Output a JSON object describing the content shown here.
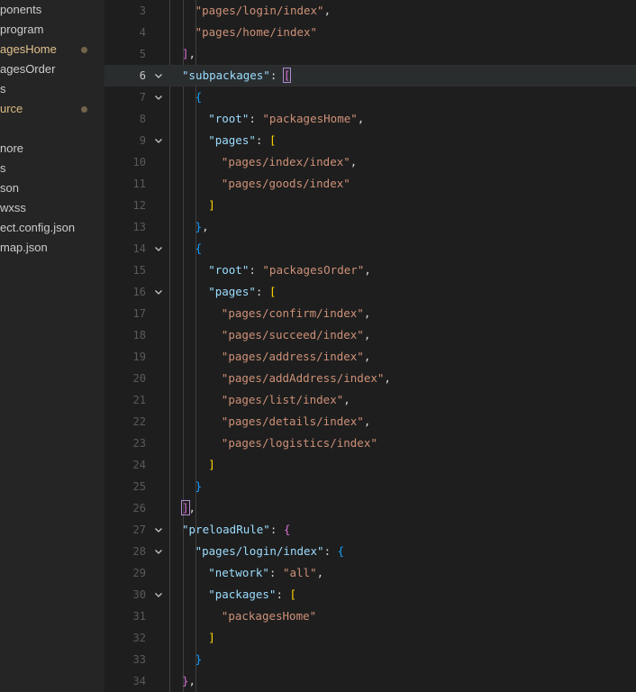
{
  "colors": {
    "sidebar_bg": "#252526",
    "editor_bg": "#1e1e1e",
    "key": "#9cdcfe",
    "string": "#ce9178",
    "punctuation": "#d4d4d4",
    "bracket_gold": "#ffd700",
    "bracket_purple": "#da70d6",
    "bracket_blue": "#179fff",
    "modified": "#e2c08d",
    "untracked": "#d7ba7d"
  },
  "explorer": {
    "items": [
      {
        "label": "ponents",
        "color": "#cccccc",
        "modified": false
      },
      {
        "label": "program",
        "color": "#cccccc",
        "modified": false
      },
      {
        "label": "agesHome",
        "color": "#e2c08d",
        "modified": true
      },
      {
        "label": "agesOrder",
        "color": "#cccccc",
        "modified": false
      },
      {
        "label": "s",
        "color": "#cccccc",
        "modified": false
      },
      {
        "label": "urce",
        "color": "#d7ba7d",
        "modified": true
      },
      {
        "label": "",
        "color": "#cccccc",
        "modified": false
      },
      {
        "label": "nore",
        "color": "#cccccc",
        "modified": false
      },
      {
        "label": "s",
        "color": "#cccccc",
        "modified": false
      },
      {
        "label": "son",
        "color": "#cccccc",
        "modified": false
      },
      {
        "label": "wxss",
        "color": "#cccccc",
        "modified": false
      },
      {
        "label": "ect.config.json",
        "color": "#cccccc",
        "modified": false
      },
      {
        "label": "map.json",
        "color": "#cccccc",
        "modified": false
      }
    ]
  },
  "editor": {
    "current_line": 6,
    "lines": [
      {
        "n": "3",
        "indent": 2,
        "fold": false,
        "tokens": [
          [
            "str",
            "\"pages/login/index\""
          ],
          [
            "punc",
            ","
          ]
        ]
      },
      {
        "n": "4",
        "indent": 2,
        "fold": false,
        "tokens": [
          [
            "str",
            "\"pages/home/index\""
          ]
        ]
      },
      {
        "n": "5",
        "indent": 1,
        "fold": false,
        "tokens": [
          [
            "b2",
            "]"
          ],
          [
            "punc",
            ","
          ]
        ]
      },
      {
        "n": "6",
        "indent": 1,
        "fold": true,
        "tokens": [
          [
            "key",
            "\"subpackages\""
          ],
          [
            "punc",
            ": "
          ],
          [
            "b2m",
            "["
          ]
        ]
      },
      {
        "n": "7",
        "indent": 2,
        "fold": true,
        "tokens": [
          [
            "b3",
            "{"
          ]
        ]
      },
      {
        "n": "8",
        "indent": 3,
        "fold": false,
        "tokens": [
          [
            "key",
            "\"root\""
          ],
          [
            "punc",
            ": "
          ],
          [
            "str",
            "\"packagesHome\""
          ],
          [
            "punc",
            ","
          ]
        ]
      },
      {
        "n": "9",
        "indent": 3,
        "fold": true,
        "tokens": [
          [
            "key",
            "\"pages\""
          ],
          [
            "punc",
            ": "
          ],
          [
            "b1",
            "["
          ]
        ]
      },
      {
        "n": "10",
        "indent": 4,
        "fold": false,
        "tokens": [
          [
            "str",
            "\"pages/index/index\""
          ],
          [
            "punc",
            ","
          ]
        ]
      },
      {
        "n": "11",
        "indent": 4,
        "fold": false,
        "tokens": [
          [
            "str",
            "\"pages/goods/index\""
          ]
        ]
      },
      {
        "n": "12",
        "indent": 3,
        "fold": false,
        "tokens": [
          [
            "b1",
            "]"
          ]
        ]
      },
      {
        "n": "13",
        "indent": 2,
        "fold": false,
        "tokens": [
          [
            "b3",
            "}"
          ],
          [
            "punc",
            ","
          ]
        ]
      },
      {
        "n": "14",
        "indent": 2,
        "fold": true,
        "tokens": [
          [
            "b3",
            "{"
          ]
        ]
      },
      {
        "n": "15",
        "indent": 3,
        "fold": false,
        "tokens": [
          [
            "key",
            "\"root\""
          ],
          [
            "punc",
            ": "
          ],
          [
            "str",
            "\"packagesOrder\""
          ],
          [
            "punc",
            ","
          ]
        ]
      },
      {
        "n": "16",
        "indent": 3,
        "fold": true,
        "tokens": [
          [
            "key",
            "\"pages\""
          ],
          [
            "punc",
            ": "
          ],
          [
            "b1",
            "["
          ]
        ]
      },
      {
        "n": "17",
        "indent": 4,
        "fold": false,
        "tokens": [
          [
            "str",
            "\"pages/confirm/index\""
          ],
          [
            "punc",
            ","
          ]
        ]
      },
      {
        "n": "18",
        "indent": 4,
        "fold": false,
        "tokens": [
          [
            "str",
            "\"pages/succeed/index\""
          ],
          [
            "punc",
            ","
          ]
        ]
      },
      {
        "n": "19",
        "indent": 4,
        "fold": false,
        "tokens": [
          [
            "str",
            "\"pages/address/index\""
          ],
          [
            "punc",
            ","
          ]
        ]
      },
      {
        "n": "20",
        "indent": 4,
        "fold": false,
        "tokens": [
          [
            "str",
            "\"pages/addAddress/index\""
          ],
          [
            "punc",
            ","
          ]
        ]
      },
      {
        "n": "21",
        "indent": 4,
        "fold": false,
        "tokens": [
          [
            "str",
            "\"pages/list/index\""
          ],
          [
            "punc",
            ","
          ]
        ]
      },
      {
        "n": "22",
        "indent": 4,
        "fold": false,
        "tokens": [
          [
            "str",
            "\"pages/details/index\""
          ],
          [
            "punc",
            ","
          ]
        ]
      },
      {
        "n": "23",
        "indent": 4,
        "fold": false,
        "tokens": [
          [
            "str",
            "\"pages/logistics/index\""
          ]
        ]
      },
      {
        "n": "24",
        "indent": 3,
        "fold": false,
        "tokens": [
          [
            "b1",
            "]"
          ]
        ]
      },
      {
        "n": "25",
        "indent": 2,
        "fold": false,
        "tokens": [
          [
            "b3",
            "}"
          ]
        ]
      },
      {
        "n": "26",
        "indent": 1,
        "fold": false,
        "tokens": [
          [
            "b2m",
            "]"
          ],
          [
            "punc",
            ","
          ]
        ]
      },
      {
        "n": "27",
        "indent": 1,
        "fold": true,
        "tokens": [
          [
            "key",
            "\"preloadRule\""
          ],
          [
            "punc",
            ": "
          ],
          [
            "b2",
            "{"
          ]
        ]
      },
      {
        "n": "28",
        "indent": 2,
        "fold": true,
        "tokens": [
          [
            "key",
            "\"pages/login/index\""
          ],
          [
            "punc",
            ": "
          ],
          [
            "b3",
            "{"
          ]
        ]
      },
      {
        "n": "29",
        "indent": 3,
        "fold": false,
        "tokens": [
          [
            "key",
            "\"network\""
          ],
          [
            "punc",
            ": "
          ],
          [
            "str",
            "\"all\""
          ],
          [
            "punc",
            ","
          ]
        ]
      },
      {
        "n": "30",
        "indent": 3,
        "fold": true,
        "tokens": [
          [
            "key",
            "\"packages\""
          ],
          [
            "punc",
            ": "
          ],
          [
            "b1",
            "["
          ]
        ]
      },
      {
        "n": "31",
        "indent": 4,
        "fold": false,
        "tokens": [
          [
            "str",
            "\"packagesHome\""
          ]
        ]
      },
      {
        "n": "32",
        "indent": 3,
        "fold": false,
        "tokens": [
          [
            "b1",
            "]"
          ]
        ]
      },
      {
        "n": "33",
        "indent": 2,
        "fold": false,
        "tokens": [
          [
            "b3",
            "}"
          ]
        ]
      },
      {
        "n": "34",
        "indent": 1,
        "fold": false,
        "tokens": [
          [
            "b2",
            "}"
          ],
          [
            "punc",
            ","
          ]
        ]
      }
    ]
  }
}
